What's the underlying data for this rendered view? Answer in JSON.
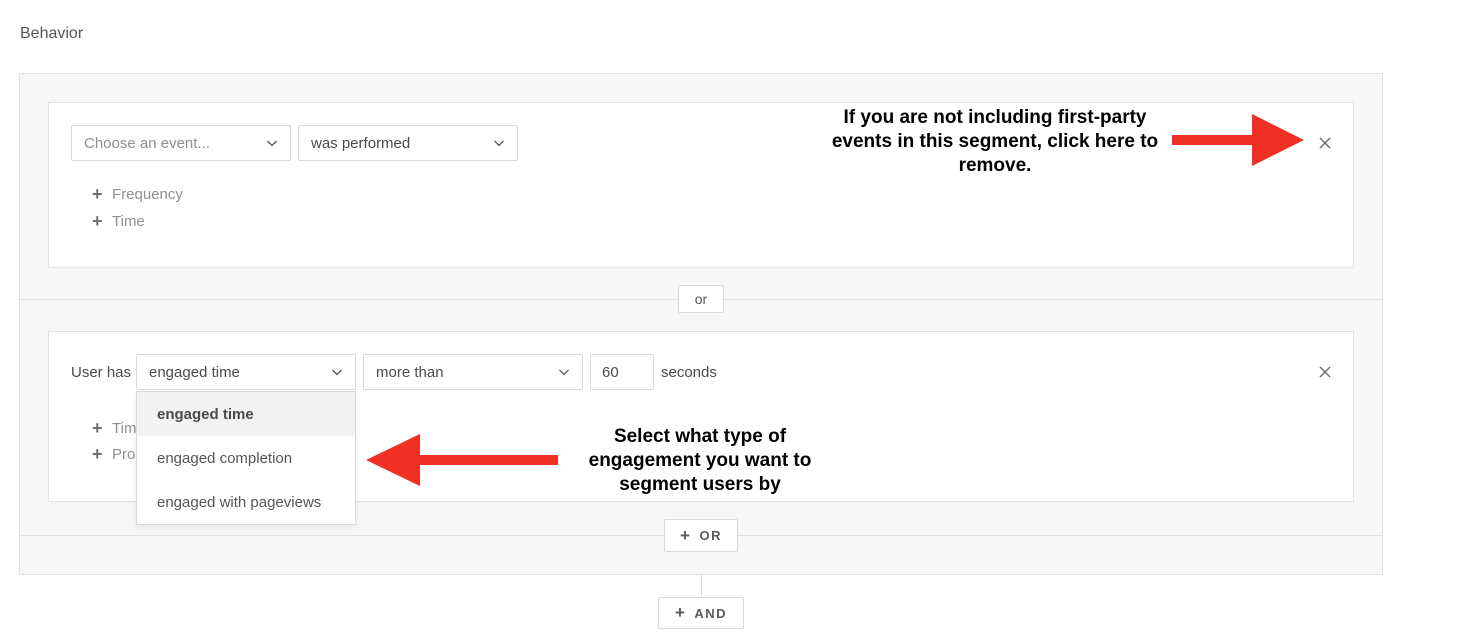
{
  "section": {
    "title": "Behavior"
  },
  "card1": {
    "event_select": {
      "placeholder": "Choose an event..."
    },
    "operator_select": {
      "value": "was performed"
    },
    "add_links": [
      {
        "label": "Frequency"
      },
      {
        "label": "Time"
      }
    ]
  },
  "or_separator": {
    "label": "or"
  },
  "card2": {
    "prefix_label": "User has",
    "metric_select": {
      "value": "engaged time"
    },
    "comparison_select": {
      "value": "more than"
    },
    "amount_input": {
      "value": "60"
    },
    "unit_label": "seconds",
    "add_links": [
      {
        "label": "Time"
      },
      {
        "label": "Properties"
      }
    ],
    "dropdown_options": [
      {
        "label": "engaged time",
        "selected": true
      },
      {
        "label": "engaged completion",
        "selected": false
      },
      {
        "label": "engaged with pageviews",
        "selected": false
      }
    ]
  },
  "buttons": {
    "or_label": "OR",
    "and_label": "AND"
  },
  "annotations": {
    "remove_note": "If you are not including first-party events in this segment, click here to remove.",
    "engagement_note": "Select what type of engagement you want to segment users by"
  },
  "colors": {
    "arrow": "#ee3124",
    "border": "#e2e2e4",
    "panel_bg": "#f7f7f8"
  },
  "icons": {
    "chevron": "chevron-down-icon",
    "close": "close-icon",
    "plus": "plus-icon",
    "arrow_right": "arrow-right-icon",
    "arrow_left": "arrow-left-icon"
  }
}
